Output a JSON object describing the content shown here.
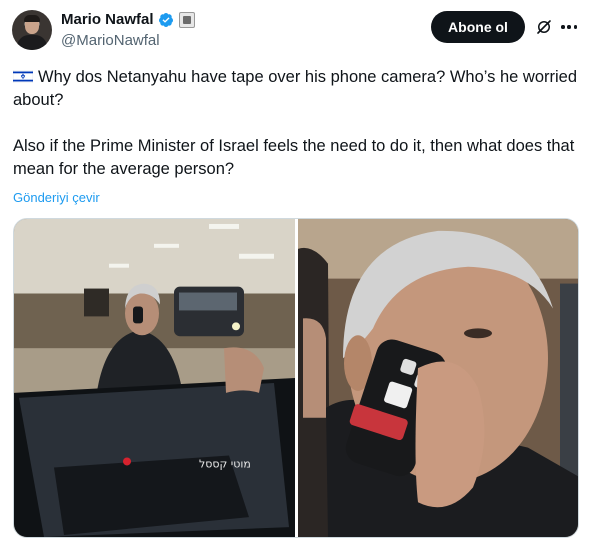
{
  "author": {
    "display_name": "Mario Nawfal",
    "handle": "@MarioNawfal",
    "verified": true
  },
  "actions": {
    "follow_label": "Abone ol"
  },
  "tweet": {
    "line1": "Why dos Netanyahu have tape over his phone camera? Who’s he worried about?",
    "line2": "Also if the Prime Minister of Israel feels the need to do it, then what does that mean for the average person?",
    "translate_label": "Gönderiyi çevir",
    "flag_icon": "israel-flag-icon"
  },
  "media": {
    "car_plate_text": "מוטי קססל"
  },
  "colors": {
    "accent": "#1d9bf0",
    "button_bg": "#0f1419",
    "muted": "#536471"
  }
}
